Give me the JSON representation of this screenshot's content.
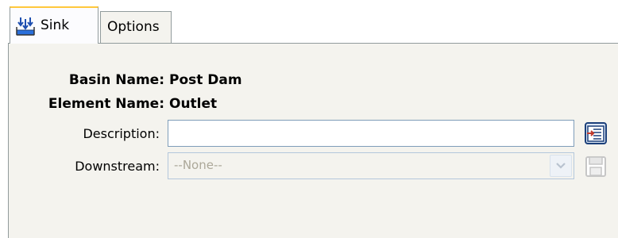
{
  "tabs": [
    {
      "label": "Sink",
      "icon": "sink-icon",
      "selected": true
    },
    {
      "label": "Options",
      "selected": false
    }
  ],
  "header": {
    "basin_label": "Basin Name:",
    "basin_value": "Post Dam",
    "element_label": "Element Name:",
    "element_value": "Outlet"
  },
  "form": {
    "description_label": "Description:",
    "description_value": "",
    "downstream_label": "Downstream:",
    "downstream_value": "--None--"
  },
  "icons": {
    "description_button": "description-editor-icon",
    "downstream_button": "save-disk-icon"
  },
  "colors": {
    "panel_bg": "#f4f3ee",
    "tab_accent": "#ffc83c",
    "disabled_text": "#aca899"
  }
}
